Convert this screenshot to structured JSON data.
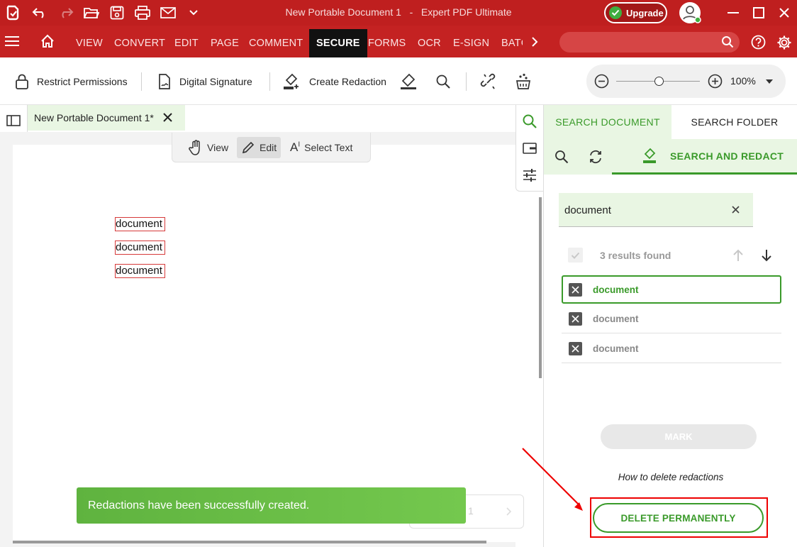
{
  "window": {
    "doc_name": "New Portable Document 1",
    "app_name": "Expert PDF Ultimate",
    "title_separator": "-",
    "upgrade_label": "Upgrade"
  },
  "ribbon": {
    "tabs": [
      "VIEW",
      "CONVERT",
      "EDIT",
      "PAGE",
      "COMMENT",
      "SECURE",
      "FORMS",
      "OCR",
      "E-SIGN",
      "BATC"
    ],
    "active_tab": "SECURE",
    "search_placeholder": ""
  },
  "toolbar": {
    "restrict_permissions": "Restrict Permissions",
    "digital_signature": "Digital Signature",
    "create_redaction": "Create Redaction",
    "zoom": "100%"
  },
  "document": {
    "tab_label": "New Portable Document 1*",
    "modes": {
      "view": "View",
      "edit": "Edit",
      "select_text": "Select Text"
    },
    "active_mode": "Edit",
    "words": [
      "document",
      "document",
      "document"
    ]
  },
  "panel": {
    "tab_search_document": "SEARCH DOCUMENT",
    "tab_search_folder": "SEARCH FOLDER",
    "search_and_redact": "SEARCH AND REDACT",
    "search_value": "document",
    "results_found": "3 results found",
    "results": [
      "document",
      "document",
      "document"
    ],
    "mark_label": "MARK",
    "howto_label": "How to delete redactions",
    "delete_label": "DELETE PERMANENTLY"
  },
  "pager": {
    "page": "1"
  },
  "toast": {
    "message": "Redactions have been successfully created."
  },
  "colors": {
    "brand_red": "#c42222",
    "accent_green": "#3a9a2a",
    "toast_green": "#6cbf48",
    "annotation_red": "#e00000"
  }
}
